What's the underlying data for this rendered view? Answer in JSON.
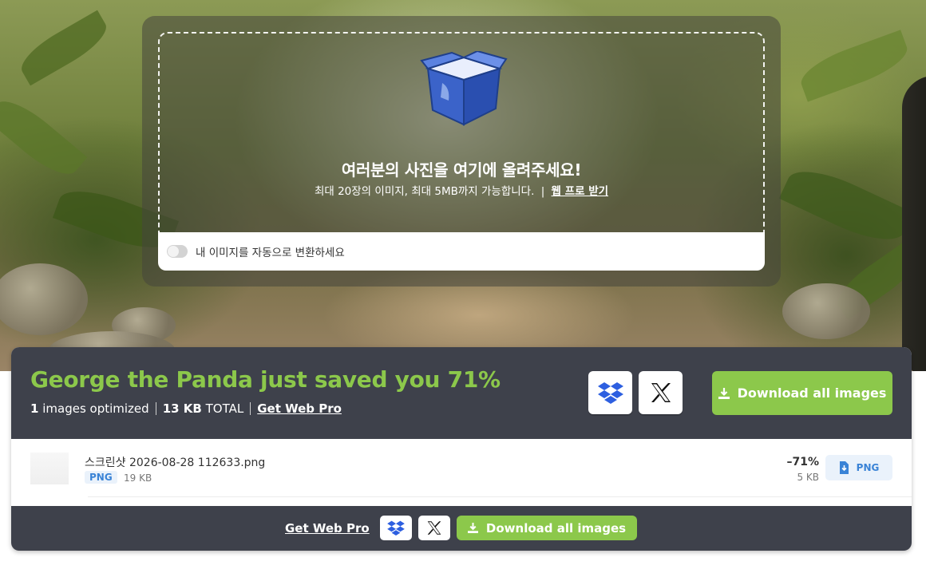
{
  "upload": {
    "title": "여러분의 사진을 여기에 올려주세요!",
    "subtitle": "최대 20장의 이미지, 최대 5MB까지 가능합니다.",
    "separator": "|",
    "web_link": "웹 프로 받기",
    "auto_convert_label": "내 이미지를 자동으로 변환하세요",
    "auto_convert_on": false
  },
  "summary": {
    "title": "George the Panda just saved you 71%",
    "images_count": "1",
    "images_label": "images optimized",
    "total_size": "13 KB",
    "total_label": "TOTAL",
    "get_pro": "Get Web Pro",
    "download_all": "Download all images"
  },
  "files": [
    {
      "name": "스크린샷 2026-08-28 112633.png",
      "format": "PNG",
      "original_size": "19 KB",
      "saving": "–71%",
      "new_size": "5 KB",
      "download_label": "PNG"
    }
  ],
  "footer": {
    "get_pro": "Get Web Pro",
    "download_all": "Download all images"
  },
  "colors": {
    "accent_green": "#8cc84b",
    "panel_dark": "#3e414b",
    "png_blue": "#3a83d6",
    "dropbox_blue": "#2d5fe0"
  },
  "icons": [
    "box-icon",
    "dropbox-icon",
    "x-logo-icon",
    "download-icon",
    "file-download-icon"
  ]
}
